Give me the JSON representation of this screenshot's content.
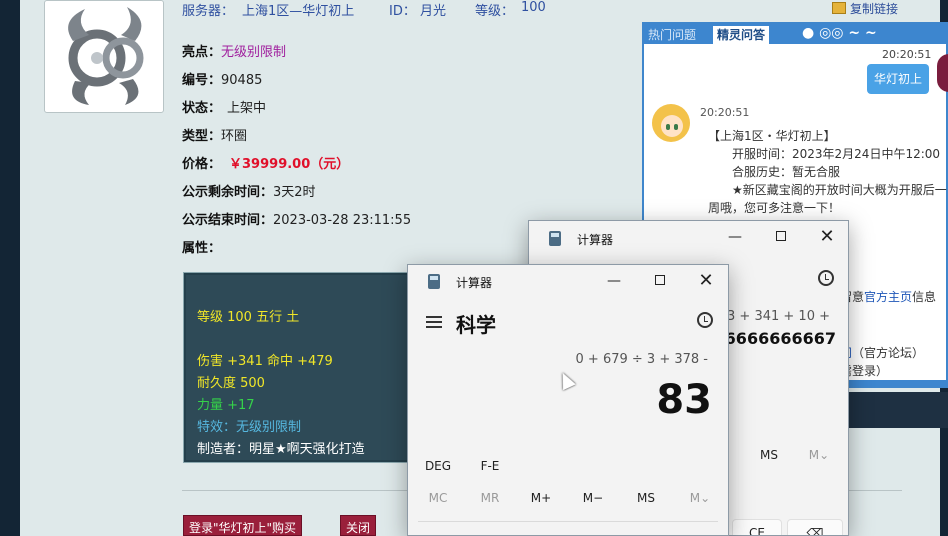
{
  "item_page": {
    "server_label": "服务器：",
    "server_value": "上海1区—华灯初上",
    "id_label": "ID：",
    "id_value": "月光",
    "level_label": "等级：",
    "level_value": "100",
    "copy_link": "复制链接",
    "highlight_label": "亮点：",
    "highlight_value": "无级别限制",
    "number_label": "编号：",
    "number_value": "90485",
    "status_label": "状态：",
    "status_value": "上架中",
    "type_label": "类型：",
    "type_value": "环圈",
    "price_label": "价格：",
    "price_value": "￥39999.00（元）",
    "remaining_label": "公示剩余时间：",
    "remaining_value": "3天2时",
    "end_label": "公示结束时间：",
    "end_value": "2023-03-28 23:11:55",
    "attr_label": "属性：",
    "attributes": [
      "等级 100 五行 土",
      "伤害 +341 命中 +479",
      "耐久度 500",
      "力量 +17",
      "特效：无级别限制",
      "制造者：明星★啊天强化打造"
    ],
    "buy_button": "登录\"华灯初上\"购买",
    "close_button": "关闭"
  },
  "qa_panel": {
    "tab_hot": "热门问题",
    "tab_spirit": "精灵问答",
    "user_bubble": "华灯初上",
    "time_right": "20:20:51",
    "time_left": "20:20:51",
    "lines": [
      "【上海1区・华灯初上】",
      "开服时间：2023年2月24日中午12:00",
      "合服历史：暂无合服",
      "★新区藏宝阁的开放时间大概为开服后一",
      "周哦，您可多注意一下！"
    ],
    "line6_pre": "留意",
    "line6_link": "官方主页",
    "line6_post": "信息",
    "line7_link": "问",
    "line7_post": "（官方论坛）",
    "line8": "需登录）"
  },
  "calc_back": {
    "title": "计算器",
    "expression": "÷ 3 + 341 + 10 +",
    "result": "666666666667",
    "ms": "MS",
    "mv": "M⌄",
    "ce": "CE"
  },
  "calc_front": {
    "title": "计算器",
    "mode": "科学",
    "expression": "0 + 679 ÷ 3 + 378 -",
    "result": "83",
    "deg": "DEG",
    "fe": "F-E",
    "mc": "MC",
    "mr": "MR",
    "mplus": "M+",
    "mminus": "M−",
    "ms": "MS",
    "mv": "M⌄"
  },
  "colors": {
    "accent_blue": "#3d86cf",
    "price_red": "#e0102a",
    "highlight_purple": "#a0209e",
    "attr_yellow": "#f0e628",
    "attr_green": "#35d24a",
    "attr_cyan": "#56b8e0"
  }
}
